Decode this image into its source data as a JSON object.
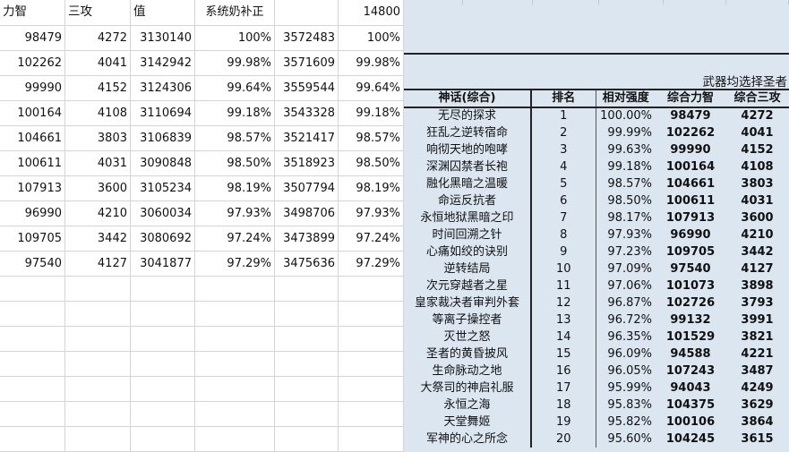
{
  "left_sheet": {
    "header": [
      "力智",
      "三攻",
      "值",
      "系统奶补正",
      "",
      "14800"
    ],
    "rows": [
      [
        "98479",
        "4272",
        "3130140",
        "100%",
        "3572483",
        "100%"
      ],
      [
        "102262",
        "4041",
        "3142942",
        "99.98%",
        "3571609",
        "99.98%"
      ],
      [
        "99990",
        "4152",
        "3124306",
        "99.64%",
        "3559544",
        "99.64%"
      ],
      [
        "100164",
        "4108",
        "3110694",
        "99.18%",
        "3543328",
        "99.18%"
      ],
      [
        "104661",
        "3803",
        "3106839",
        "98.57%",
        "3521417",
        "98.57%"
      ],
      [
        "100611",
        "4031",
        "3090848",
        "98.50%",
        "3518923",
        "98.50%"
      ],
      [
        "107913",
        "3600",
        "3105234",
        "98.19%",
        "3507794",
        "98.19%"
      ],
      [
        "96990",
        "4210",
        "3060034",
        "97.93%",
        "3498706",
        "97.93%"
      ],
      [
        "109705",
        "3442",
        "3080692",
        "97.24%",
        "3473899",
        "97.24%"
      ],
      [
        "97540",
        "4127",
        "3041877",
        "97.29%",
        "3475636",
        "97.29%"
      ]
    ],
    "empty_rows": 7
  },
  "right_panel": {
    "note": "武器均选择圣者",
    "columns": [
      "神话(综合)",
      "排名",
      "相对强度",
      "综合力智",
      "综合三攻"
    ],
    "rows": [
      [
        "无尽的探求",
        "1",
        "100.00%",
        "98479",
        "4272"
      ],
      [
        "狂乱之逆转宿命",
        "2",
        "99.99%",
        "102262",
        "4041"
      ],
      [
        "响彻天地的咆哮",
        "3",
        "99.63%",
        "99990",
        "4152"
      ],
      [
        "深渊囚禁者长袍",
        "4",
        "99.18%",
        "100164",
        "4108"
      ],
      [
        "融化黑暗之温暖",
        "5",
        "98.57%",
        "104661",
        "3803"
      ],
      [
        "命运反抗者",
        "6",
        "98.50%",
        "100611",
        "4031"
      ],
      [
        "永恒地狱黑暗之印",
        "7",
        "98.17%",
        "107913",
        "3600"
      ],
      [
        "时间回溯之针",
        "8",
        "97.93%",
        "96990",
        "4210"
      ],
      [
        "心痛如绞的诀别",
        "9",
        "97.23%",
        "109705",
        "3442"
      ],
      [
        "逆转结局",
        "10",
        "97.09%",
        "97540",
        "4127"
      ],
      [
        "次元穿越者之星",
        "11",
        "97.06%",
        "101073",
        "3898"
      ],
      [
        "皇家裁决者审判外套",
        "12",
        "96.87%",
        "102726",
        "3793"
      ],
      [
        "等离子操控者",
        "13",
        "96.72%",
        "99132",
        "3991"
      ],
      [
        "灭世之怒",
        "14",
        "96.35%",
        "101529",
        "3821"
      ],
      [
        "圣者的黄昏披风",
        "15",
        "96.09%",
        "94588",
        "4221"
      ],
      [
        "生命脉动之地",
        "16",
        "96.05%",
        "107243",
        "3487"
      ],
      [
        "大祭司的神启礼服",
        "17",
        "95.99%",
        "94043",
        "4249"
      ],
      [
        "永恒之海",
        "18",
        "95.83%",
        "104375",
        "3629"
      ],
      [
        "天堂舞姬",
        "19",
        "95.82%",
        "100106",
        "3864"
      ],
      [
        "军神的心之所念",
        "20",
        "95.60%",
        "104245",
        "3615"
      ]
    ]
  }
}
